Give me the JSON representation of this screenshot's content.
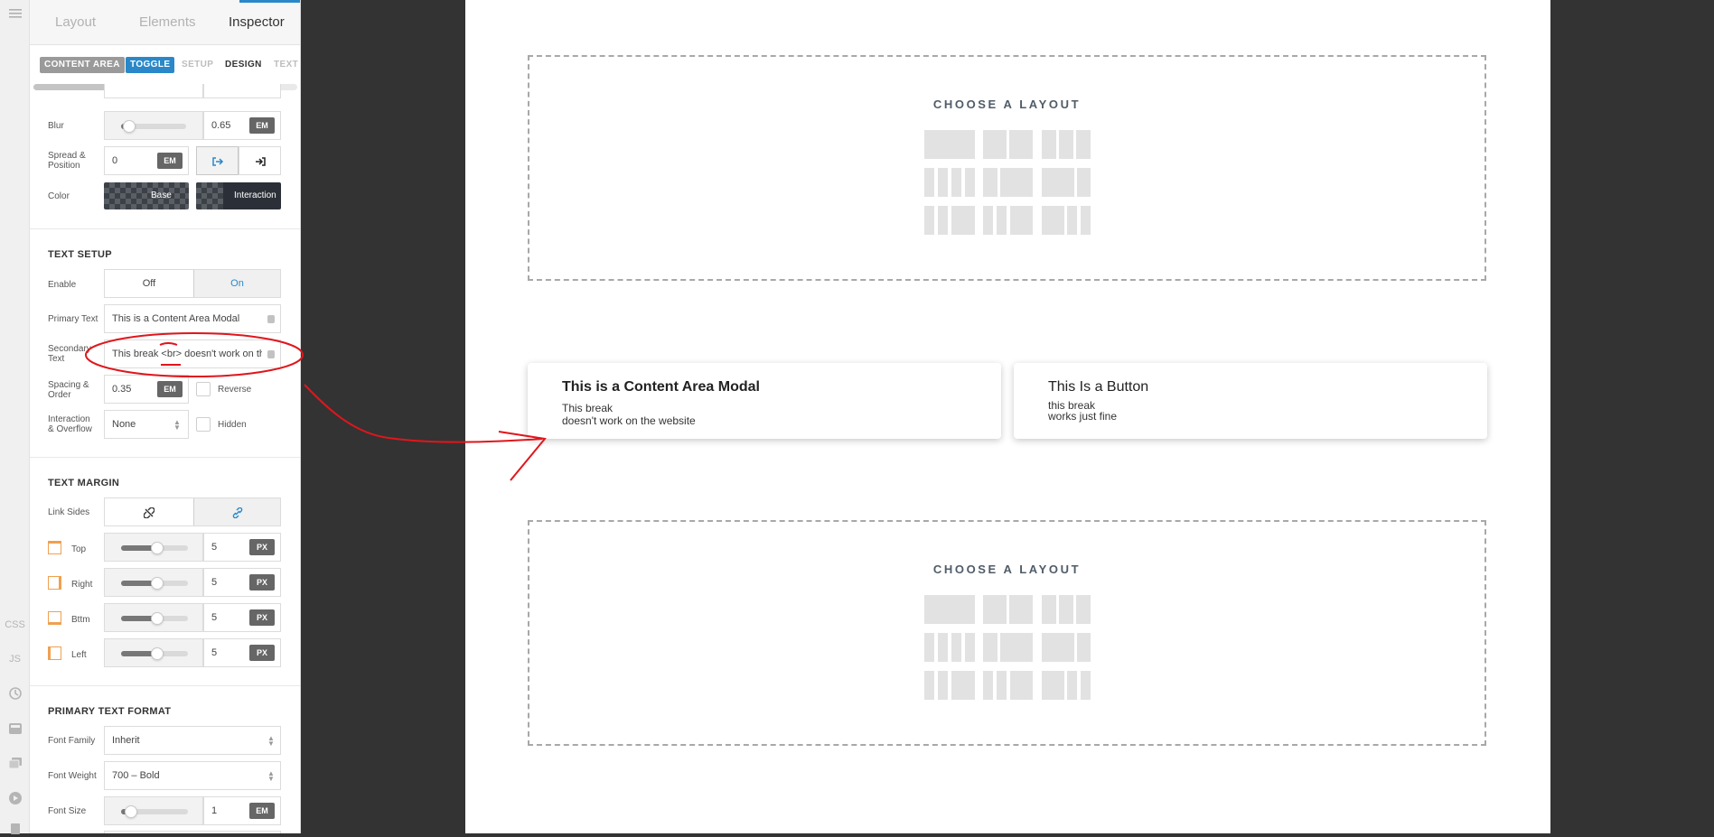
{
  "panel": {
    "tabs": [
      "Layout",
      "Elements",
      "Inspector"
    ],
    "breadcrumbs": [
      "CONTENT AREA",
      "TOGGLE",
      "SETUP",
      "DESIGN",
      "TEXT"
    ]
  },
  "shadow": {
    "blur_label": "Blur",
    "blur_value": "0.65",
    "blur_unit": "EM",
    "spread_label": "Spread & Position",
    "spread_value": "0",
    "spread_unit": "EM",
    "color_label": "Color",
    "color_base": "Base",
    "color_interaction": "Interaction"
  },
  "text_setup": {
    "heading": "TEXT SETUP",
    "enable_label": "Enable",
    "enable_off": "Off",
    "enable_on": "On",
    "primary_label": "Primary Text",
    "primary_value": "This is a Content Area Modal",
    "secondary_label": "Secondary Text",
    "secondary_value": "This break <br> doesn't work on the website",
    "spacing_label": "Spacing & Order",
    "spacing_value": "0.35",
    "spacing_unit": "EM",
    "reverse_label": "Reverse",
    "interaction_label": "Interaction & Overflow",
    "interaction_value": "None",
    "hidden_label": "Hidden"
  },
  "text_margin": {
    "heading": "TEXT MARGIN",
    "link_label": "Link Sides",
    "sides": [
      {
        "label": "Top",
        "value": "5",
        "unit": "PX"
      },
      {
        "label": "Right",
        "value": "5",
        "unit": "PX"
      },
      {
        "label": "Bttm",
        "value": "5",
        "unit": "PX"
      },
      {
        "label": "Left",
        "value": "5",
        "unit": "PX"
      }
    ]
  },
  "primary_text_format": {
    "heading": "PRIMARY TEXT FORMAT",
    "font_family_label": "Font Family",
    "font_family_value": "Inherit",
    "font_weight_label": "Font Weight",
    "font_weight_value": "700 – Bold",
    "font_size_label": "Font Size",
    "font_size_value": "1",
    "font_size_unit": "EM"
  },
  "rail": {
    "css": "CSS",
    "js": "JS"
  },
  "canvas": {
    "layout_title": "CHOOSE A LAYOUT",
    "modal_card": {
      "title": "This is a Content Area Modal",
      "line1": "This break",
      "line2": "doesn't work on the website"
    },
    "button_card": {
      "title": "This Is a Button",
      "line1": "this break",
      "line2": "works just fine"
    }
  },
  "colors": {
    "accent": "#2a88c9",
    "annotation": "#e0161c",
    "backdrop": "#333333"
  }
}
